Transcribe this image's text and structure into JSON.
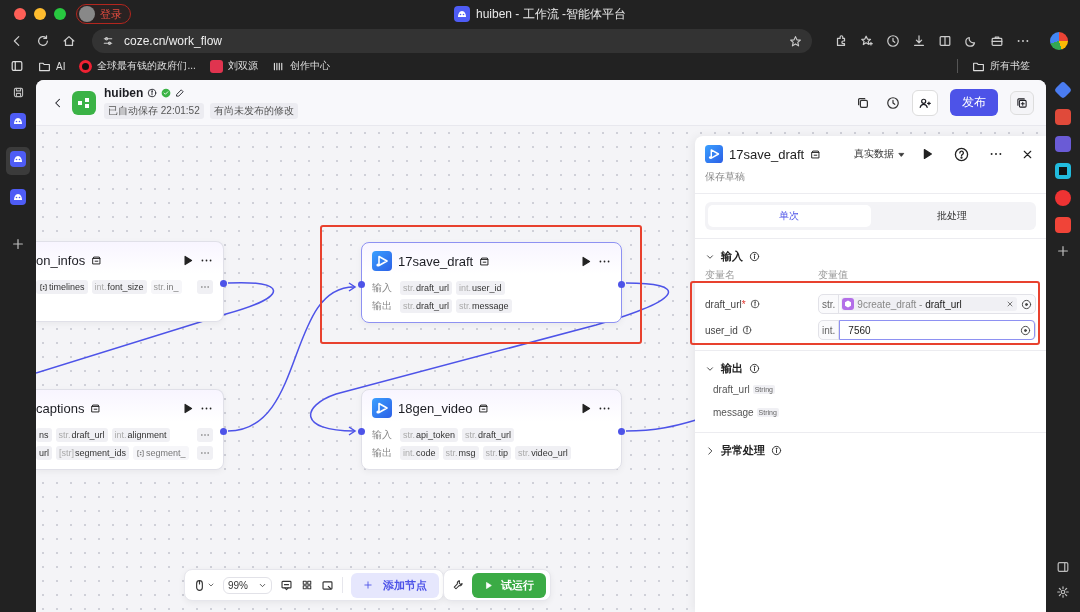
{
  "browser": {
    "profile": "登录",
    "tab_title": "huiben - 工作流 -智能体平台",
    "url": "coze.cn/work_flow",
    "bookmarks": [
      {
        "label": "AI",
        "kind": "folder"
      },
      {
        "label": "全球最有钱的政府们...",
        "kind": "video"
      },
      {
        "label": "刘双源",
        "kind": "red"
      },
      {
        "label": "创作中心",
        "kind": "bars"
      }
    ],
    "all_bookmarks": "所有书签"
  },
  "sidebar_apps": [
    {
      "selected": false
    },
    {
      "selected": true
    },
    {
      "selected": false
    }
  ],
  "header": {
    "app_name": "huiben",
    "autosave": "已自动保存 22:01:52",
    "unpublished": "有尚未发布的修改",
    "publish": "发布"
  },
  "nodes": [
    {
      "title": "on_infos",
      "selected": false,
      "rows": [
        {
          "pills": [
            {
              "array": true,
              "name": "timelines"
            },
            {
              "type": "int.",
              "name": "font_size"
            },
            {
              "type": "str.",
              "name": "in_",
              "faded": true
            }
          ],
          "more": true
        }
      ]
    },
    {
      "title": "captions",
      "selected": false,
      "rows": [
        {
          "pills": [
            {
              "name": "ns"
            },
            {
              "type": "str.",
              "name": "draft_url"
            },
            {
              "type": "int.",
              "name": "alignment"
            }
          ],
          "more": true
        },
        {
          "pills": [
            {
              "name": "url"
            },
            {
              "type": "[str]",
              "name": "segment_ids"
            },
            {
              "array": true,
              "name": "segment_",
              "faded": true
            }
          ],
          "more": true
        }
      ]
    },
    {
      "title": "17save_draft",
      "selected": true,
      "rows": [
        {
          "label": "输入",
          "pills": [
            {
              "type": "str.",
              "name": "draft_url"
            },
            {
              "type": "int.",
              "name": "user_id"
            }
          ]
        },
        {
          "label": "输出",
          "pills": [
            {
              "type": "str.",
              "name": "draft_url"
            },
            {
              "type": "str.",
              "name": "message"
            }
          ]
        }
      ]
    },
    {
      "title": "18gen_video",
      "selected": false,
      "rows": [
        {
          "label": "输入",
          "pills": [
            {
              "type": "str.",
              "name": "api_token"
            },
            {
              "type": "str.",
              "name": "draft_url"
            }
          ]
        },
        {
          "label": "输出",
          "pills": [
            {
              "type": "int.",
              "name": "code"
            },
            {
              "type": "str.",
              "name": "msg"
            },
            {
              "type": "str.",
              "name": "tip"
            },
            {
              "type": "str.",
              "name": "video_url"
            }
          ]
        }
      ]
    }
  ],
  "panel": {
    "title": "17save_draft",
    "data_mode": "真实数据",
    "subtitle": "保存草稿",
    "tabs": [
      {
        "label": "单次",
        "selected": true
      },
      {
        "label": "批处理",
        "selected": false
      }
    ],
    "input": {
      "title": "输入",
      "expanded": true,
      "col_name": "变量名",
      "col_value": "变量值",
      "params": [
        {
          "name": "draft_url",
          "mark": "*",
          "type": "str.",
          "kind": "reference",
          "value": "9create_draft - **draft_url**",
          "focused": false
        },
        {
          "name": "user_id",
          "type": "int.",
          "kind": "literal",
          "value": "7560",
          "focused": true
        }
      ]
    },
    "output": {
      "title": "输出",
      "expanded": true,
      "params": [
        {
          "name": "draft_url",
          "type": "String"
        },
        {
          "name": "message",
          "type": "String"
        }
      ]
    },
    "error": {
      "title": "异常处理",
      "expanded": false
    }
  },
  "toolbar": {
    "zoom": "99%",
    "add_node": "添加节点",
    "run": "试运行"
  }
}
